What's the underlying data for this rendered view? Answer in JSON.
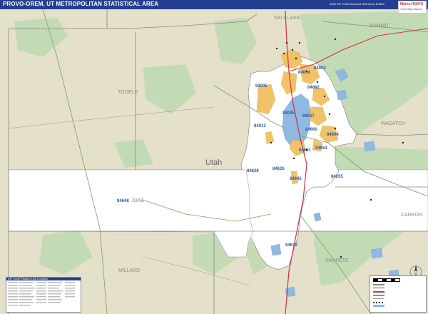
{
  "header": {
    "title": "PROVO-OREM, UT METROPOLITAN STATISTICAL AREA",
    "edition": "2016 ZIP Code Business Reference Edition"
  },
  "logo": {
    "main": "Market MAPS",
    "sub": "Your Map Source"
  },
  "county_labels": {
    "salt_lake": "SALT LAKE",
    "summit": "SUMMIT",
    "tooele": "TOOELE",
    "wasatch": "WASATCH",
    "utah": "Utah",
    "juab": "JUAB",
    "carbon": "CARBON",
    "sanpete": "SANPETE",
    "millard": "MILLARD"
  },
  "zip_labels": {
    "z84003": "84003",
    "z84004": "84004",
    "z84062": "84062",
    "z84005": "84005",
    "z84045": "84045",
    "z84057": "84057",
    "z84013": "84013",
    "z84604": "84604",
    "z84660": "84660",
    "z84653": "84653",
    "z84651": "84651",
    "z84628": "84628",
    "z84626": "84626",
    "z84645": "84645",
    "z84655": "84655",
    "z84648": "84648",
    "z84639": "84639"
  },
  "zip_table": {
    "title": "ZIP Code Related Unit Location"
  },
  "colors": {
    "header": "#243f8f",
    "land_outside": "#e4e0c9",
    "forest": "#c2dbb5",
    "msa_white": "#ffffff",
    "urban_orange": "#f2c266",
    "lake_blue": "#90b8e0",
    "zip_text": "#2a5aa8",
    "county_text": "#8a8a8a",
    "highway_red": "#d0313f",
    "county_border": "#888888"
  }
}
